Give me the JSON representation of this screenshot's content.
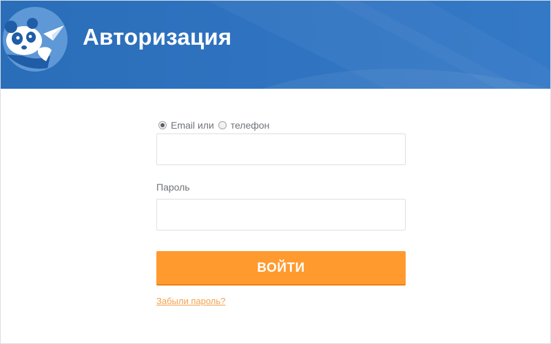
{
  "header": {
    "title": "Авторизация",
    "logo_icon": "panda-logo-icon",
    "background_color": "#2f73c0"
  },
  "login_form": {
    "login_type": {
      "selected": "email",
      "option_email_label": "Email или",
      "option_phone_label": "телефон"
    },
    "login_field": {
      "value": "",
      "placeholder": ""
    },
    "password_label": "Пароль",
    "password_field": {
      "value": "",
      "placeholder": ""
    },
    "submit_label": "ВОЙТИ",
    "submit_color": "#ff9a2e",
    "forgot_link": "Забыли пароль?",
    "link_color": "#f3a04c"
  }
}
